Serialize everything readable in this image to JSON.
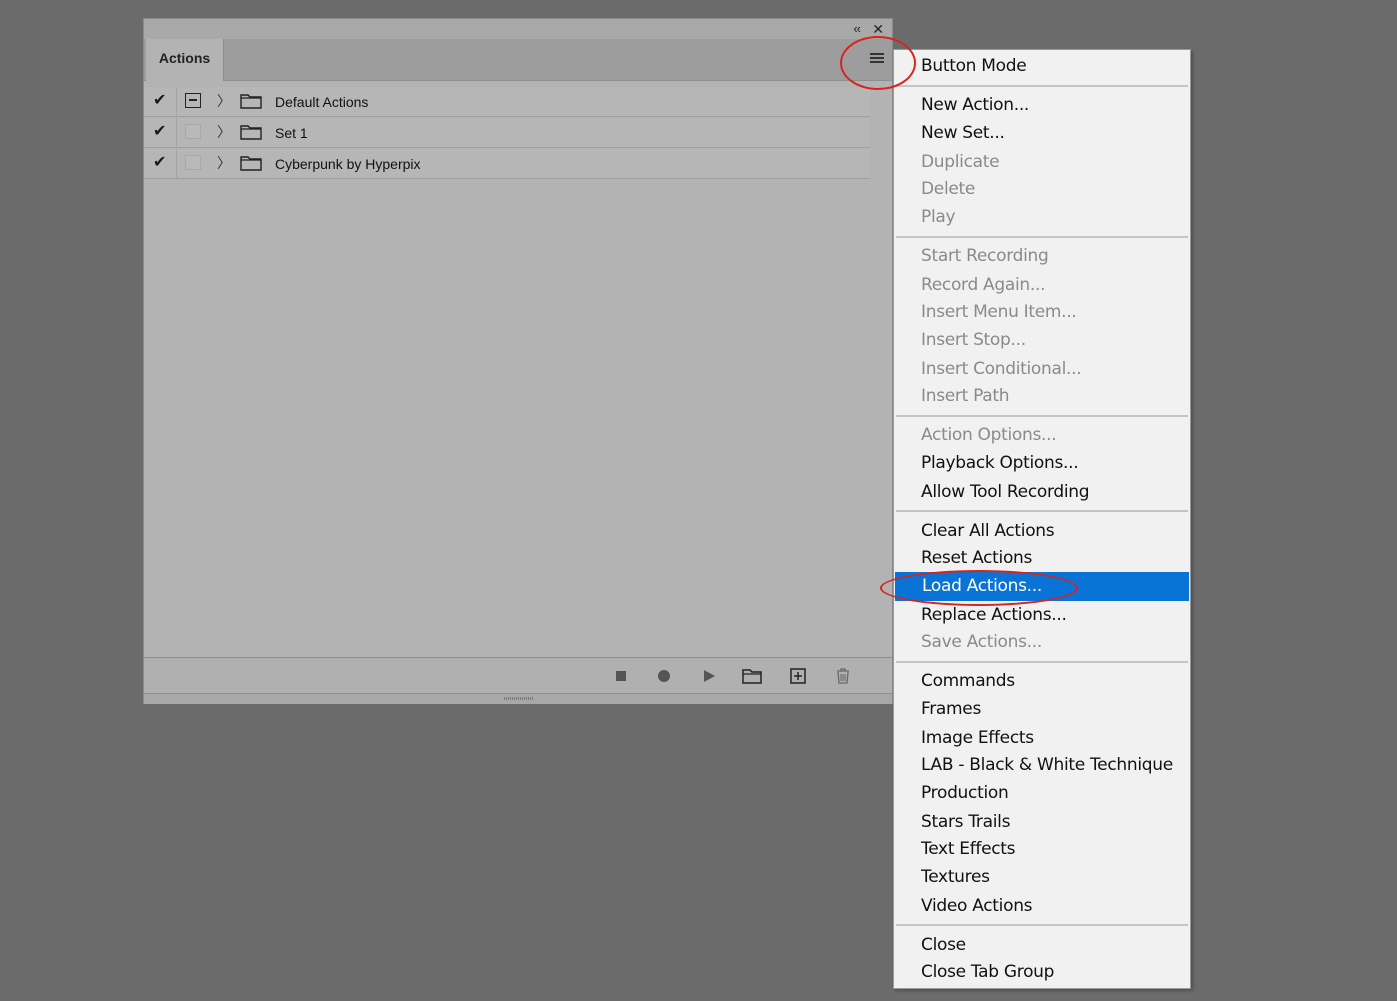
{
  "panel": {
    "tab_label": "Actions",
    "collapse_glyph": "‹‹",
    "close_glyph": "✕",
    "rows": [
      {
        "label": "Default Actions",
        "checked": true,
        "dialog_on": true
      },
      {
        "label": "Set 1",
        "checked": true,
        "dialog_on": false
      },
      {
        "label": "Cyberpunk by Hyperpix",
        "checked": true,
        "dialog_on": false
      }
    ],
    "footer_buttons": [
      "stop-icon",
      "record-icon",
      "play-icon",
      "new-set-folder-icon",
      "new-action-icon",
      "trash-icon"
    ]
  },
  "menu": {
    "items": [
      {
        "label": "Button Mode",
        "state": "enabled"
      },
      {
        "label": "New Action...",
        "state": "enabled"
      },
      {
        "label": "New Set...",
        "state": "enabled"
      },
      {
        "label": "Duplicate",
        "state": "disabled"
      },
      {
        "label": "Delete",
        "state": "disabled"
      },
      {
        "label": "Play",
        "state": "disabled"
      },
      {
        "label": "Start Recording",
        "state": "disabled"
      },
      {
        "label": "Record Again...",
        "state": "disabled"
      },
      {
        "label": "Insert Menu Item...",
        "state": "disabled"
      },
      {
        "label": "Insert Stop...",
        "state": "disabled"
      },
      {
        "label": "Insert Conditional...",
        "state": "disabled"
      },
      {
        "label": "Insert Path",
        "state": "disabled"
      },
      {
        "label": "Action Options...",
        "state": "disabled"
      },
      {
        "label": "Playback Options...",
        "state": "enabled"
      },
      {
        "label": "Allow Tool Recording",
        "state": "enabled"
      },
      {
        "label": "Clear All Actions",
        "state": "enabled"
      },
      {
        "label": "Reset Actions",
        "state": "enabled"
      },
      {
        "label": "Load Actions...",
        "state": "highlighted"
      },
      {
        "label": "Replace Actions...",
        "state": "enabled"
      },
      {
        "label": "Save Actions...",
        "state": "disabled"
      },
      {
        "label": "Commands",
        "state": "enabled"
      },
      {
        "label": "Frames",
        "state": "enabled"
      },
      {
        "label": "Image Effects",
        "state": "enabled"
      },
      {
        "label": "LAB - Black & White Technique",
        "state": "enabled"
      },
      {
        "label": "Production",
        "state": "enabled"
      },
      {
        "label": "Stars Trails",
        "state": "enabled"
      },
      {
        "label": "Text Effects",
        "state": "enabled"
      },
      {
        "label": "Textures",
        "state": "enabled"
      },
      {
        "label": "Video Actions",
        "state": "enabled"
      },
      {
        "label": "Close",
        "state": "enabled"
      },
      {
        "label": "Close Tab Group",
        "state": "enabled"
      }
    ]
  },
  "colors": {
    "highlight": "#0a74d6",
    "annotation": "#d9231e"
  }
}
